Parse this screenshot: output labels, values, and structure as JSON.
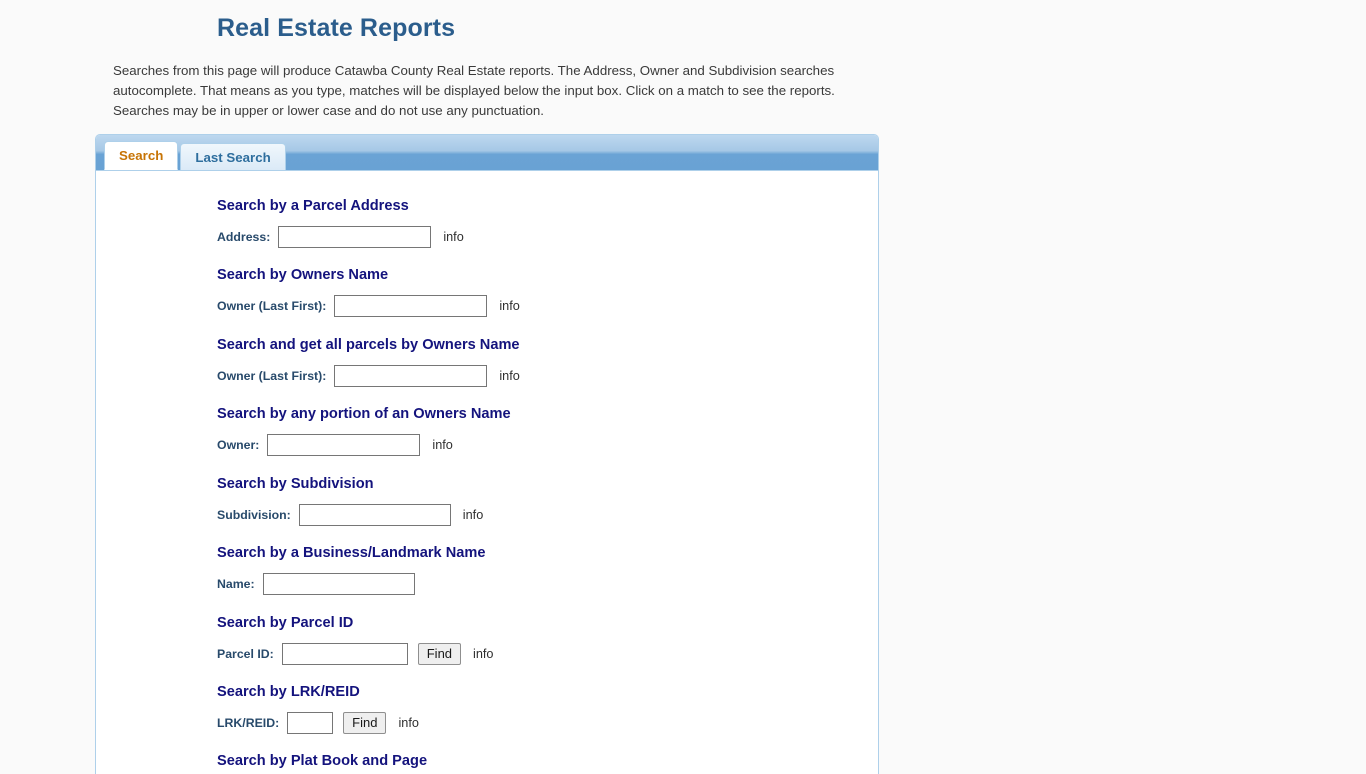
{
  "page": {
    "title": "Real Estate Reports",
    "intro": "Searches from this page will produce Catawba County Real Estate reports. The Address, Owner and Subdivision searches autocomplete. That means as you type, matches will be displayed below the input box. Click on a match to see the reports. Searches may be in upper or lower case and do not use any punctuation.",
    "title_color": "#2b5d8c",
    "heading_color": "#14137d",
    "label_color": "#284a6b",
    "active_tab_color": "#c77405"
  },
  "tabs": [
    {
      "label": "Search",
      "active": true
    },
    {
      "label": "Last Search",
      "active": false
    }
  ],
  "sections": [
    {
      "heading": "Search by a Parcel Address",
      "label": "Address:",
      "value": "",
      "input_width": 153,
      "info": "info",
      "button": null
    },
    {
      "heading": "Search by Owners Name",
      "label": "Owner (Last First):",
      "value": "",
      "input_width": 153,
      "info": "info",
      "button": null
    },
    {
      "heading": "Search and get all parcels by Owners Name",
      "label": "Owner (Last First):",
      "value": "",
      "input_width": 153,
      "info": "info",
      "button": null
    },
    {
      "heading": "Search by any portion of an Owners Name",
      "label": "Owner:",
      "value": "",
      "input_width": 153,
      "info": "info",
      "button": null
    },
    {
      "heading": "Search by Subdivision",
      "label": "Subdivision:",
      "value": "",
      "input_width": 152,
      "info": "info",
      "button": null
    },
    {
      "heading": "Search by a Business/Landmark Name",
      "label": "Name:",
      "value": "",
      "input_width": 152,
      "info": "",
      "button": null
    },
    {
      "heading": "Search by Parcel ID",
      "label": "Parcel ID:",
      "value": "",
      "input_width": 126,
      "info": "info",
      "button": "Find"
    },
    {
      "heading": "Search by LRK/REID",
      "label": "LRK/REID:",
      "value": "",
      "input_width": 46,
      "info": "info",
      "button": "Find"
    },
    {
      "heading": "Search by Plat Book and Page",
      "label": "",
      "value": "",
      "input_width": 0,
      "info": "",
      "button": null
    }
  ]
}
